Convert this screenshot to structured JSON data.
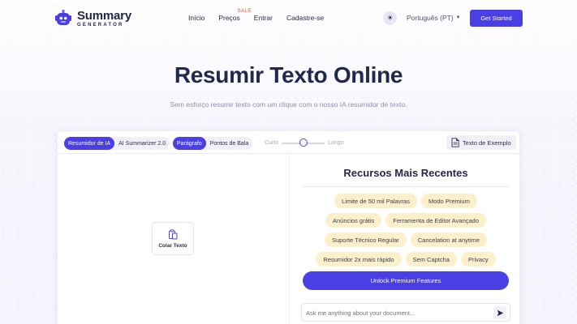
{
  "brand": {
    "title": "Summary",
    "subtitle": "GENERATOR",
    "accent_color": "#4a3fe5"
  },
  "nav": {
    "items": [
      {
        "label": "Início"
      },
      {
        "label": "Preços",
        "badge": "SALE"
      },
      {
        "label": "Entrar"
      },
      {
        "label": "Cadastre-se"
      }
    ]
  },
  "header": {
    "theme_icon": "sun-icon",
    "language": "Português (PT)",
    "cta_label": "Get Started"
  },
  "hero": {
    "title": "Resumir Texto Online",
    "subtitle": "Sem esforço resumir texto com um clique com o nosso IA resumidor de texto."
  },
  "toolbar": {
    "model_options": [
      {
        "label": "Resumidor de IA",
        "active": true
      },
      {
        "label": "AI Summarizer 2.0",
        "active": false
      }
    ],
    "format_options": [
      {
        "label": "Parágrafo",
        "active": true
      },
      {
        "label": "Pontos de Bala",
        "active": false
      }
    ],
    "length": {
      "min_label": "Curto",
      "max_label": "Longo",
      "value": 0.5
    },
    "sample_label": "Texto de Exemplo"
  },
  "input_pane": {
    "paste_label": "Colar Texto"
  },
  "features": {
    "title": "Recursos Mais Recentes",
    "rows": [
      [
        "Limite de 50 mil Palavras",
        "Modo Premium"
      ],
      [
        "Anúncios grátis",
        "Ferramenta de Editor Avançado"
      ],
      [
        "Suporte Técnico Regular",
        "Cancelation at anytime"
      ],
      [
        "Resumidor 2x mais rápido",
        "Sem Captcha",
        "Privacy"
      ]
    ],
    "tag_color": "#fbf0c9",
    "unlock_label": "Unlock Premium Features"
  },
  "chat": {
    "placeholder": "Ask me anything about your document..."
  }
}
